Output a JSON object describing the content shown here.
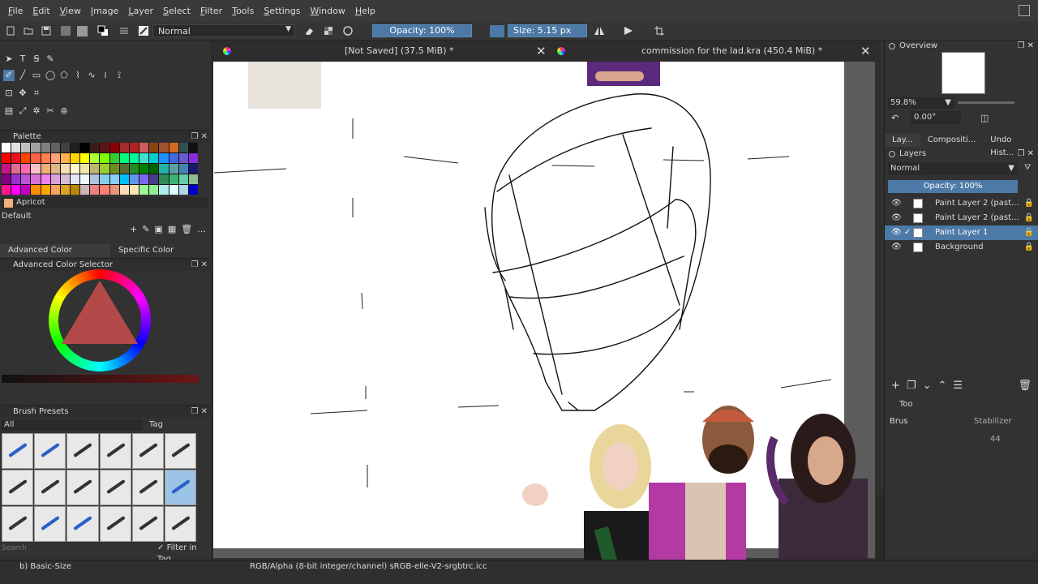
{
  "menu": [
    "File",
    "Edit",
    "View",
    "Image",
    "Layer",
    "Select",
    "Filter",
    "Tools",
    "Settings",
    "Window",
    "Help"
  ],
  "toolbar": {
    "blend_mode": "Normal",
    "opacity": "Opacity: 100%",
    "size": "Size: 5.15 px"
  },
  "palette": {
    "title": "Palette",
    "current_color": "Apricot",
    "set_name": "Default",
    "colors": [
      "#ffffff",
      "#e0e0e0",
      "#c0c0c0",
      "#a0a0a0",
      "#808080",
      "#606060",
      "#404040",
      "#202020",
      "#000000",
      "#3a1a1a",
      "#5c1414",
      "#8b0000",
      "#a52a2a",
      "#b22222",
      "#cd5c5c",
      "#8b4513",
      "#a0522d",
      "#d2691e",
      "#2f4f4f",
      "#111111",
      "#ff0000",
      "#e81123",
      "#ff4500",
      "#ff6347",
      "#ff7f50",
      "#ffa07a",
      "#ffb347",
      "#ffd700",
      "#ffff00",
      "#adff2f",
      "#7fff00",
      "#32cd32",
      "#00ff7f",
      "#00fa9a",
      "#40e0d0",
      "#00ced1",
      "#1e90ff",
      "#4169e1",
      "#6a5acd",
      "#8a2be2",
      "#c71585",
      "#db7093",
      "#ff69b4",
      "#ffc0cb",
      "#f2b07a",
      "#deb887",
      "#f5deb3",
      "#fffacd",
      "#eee8aa",
      "#bdb76b",
      "#9acd32",
      "#6b8e23",
      "#556b2f",
      "#228b22",
      "#008000",
      "#006400",
      "#20b2aa",
      "#5f9ea0",
      "#4682b4",
      "#191970",
      "#800080",
      "#9932cc",
      "#ba55d3",
      "#da70d6",
      "#ee82ee",
      "#dda0dd",
      "#d8bfd8",
      "#e6e6fa",
      "#f0f8ff",
      "#b0c4de",
      "#87ceeb",
      "#87cefa",
      "#00bfff",
      "#6495ed",
      "#7b68ee",
      "#483d8b",
      "#2e8b57",
      "#3cb371",
      "#66cdaa",
      "#8fbc8f",
      "#ff1493",
      "#ff00ff",
      "#c000c0",
      "#ff8c00",
      "#ffa500",
      "#f4a460",
      "#daa520",
      "#b8860b",
      "#cdb7b5",
      "#f08080",
      "#fa8072",
      "#e9967a",
      "#ffdab9",
      "#ffe4b5",
      "#98fb98",
      "#90ee90",
      "#afeeee",
      "#e0ffff",
      "#add8e6",
      "#0000cd"
    ]
  },
  "color_tabs": [
    "Advanced Color Selector",
    "Specific Color Selector"
  ],
  "advanced_color_selector": {
    "title": "Advanced Color Selector"
  },
  "brush_presets": {
    "title": "Brush Presets",
    "filter": "All",
    "tag_button": "Tag",
    "search_placeholder": "Search",
    "filter_in_tag": "Filter in Tag"
  },
  "documents": [
    {
      "title": "[Not Saved]  (37.5 MiB) *"
    },
    {
      "title": "commission for the lad.kra (450.4 MiB) *"
    }
  ],
  "overview": {
    "title": "Overview",
    "zoom": "59.8%",
    "rotation": "0.00°"
  },
  "right_tabs": [
    "Lay...",
    "Compositi...",
    "Undo Hist..."
  ],
  "layers": {
    "title": "Layers",
    "blend_mode": "Normal",
    "opacity": "Opacity:  100%",
    "items": [
      {
        "name": "Paint Layer 2 (past..."
      },
      {
        "name": "Paint Layer 2 (past..."
      },
      {
        "name": "Paint Layer 1"
      },
      {
        "name": "Background"
      }
    ]
  },
  "tool_options": {
    "title": "Too",
    "brush_label": "Brus",
    "stabilizer": "Stabilizer",
    "value": "44"
  },
  "status": {
    "brush": "b) Basic-Size",
    "color_profile": "RGB/Alpha (8-bit integer/channel)  sRGB-elle-V2-srgbtrc.icc"
  }
}
